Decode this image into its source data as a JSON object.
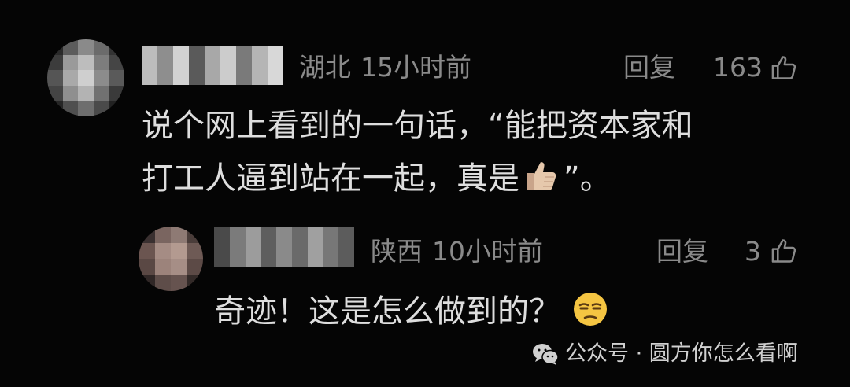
{
  "comments": [
    {
      "author_hidden": true,
      "location": "湖北",
      "time": "15小时前",
      "reply_label": "回复",
      "likes": "163",
      "text_line1": "说个网上看到的一句话，“能把资本家和",
      "text_line2_before": "打工人逼到站在一起，真是",
      "text_line2_emoji": "thumbs-up-emoji",
      "text_line2_after": "”。"
    }
  ],
  "reply": {
    "author_hidden": true,
    "location": "陕西",
    "time": "10小时前",
    "reply_label": "回复",
    "likes": "3",
    "text": "奇迹！这是怎么做到的？",
    "emoji": "unamused-face-emoji"
  },
  "watermark": {
    "icon": "wechat-icon",
    "text": "公众号 · 圆方你怎么看啊"
  },
  "colors": {
    "background": "#050505",
    "meta_text": "#8a8a8a",
    "body_text": "#dedede"
  }
}
